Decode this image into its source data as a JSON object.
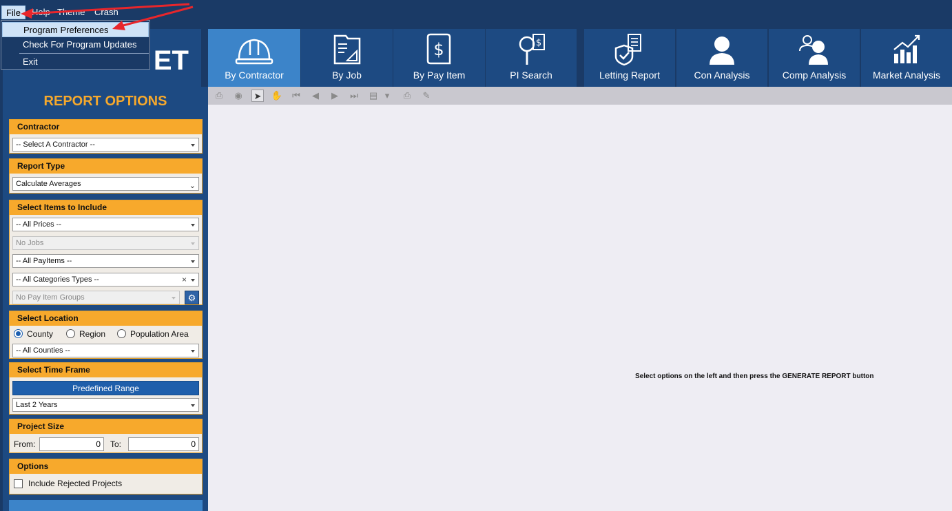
{
  "menubar": {
    "items": [
      {
        "label": "File"
      },
      {
        "label": "Help"
      },
      {
        "label": "Theme"
      },
      {
        "label": "Crash"
      }
    ]
  },
  "file_menu": {
    "items": [
      {
        "label": "Program Preferences"
      },
      {
        "label": "Check For Program Updates"
      },
      {
        "label": "Exit"
      }
    ]
  },
  "logo": {
    "text": "ET"
  },
  "tabs": [
    {
      "label": "By Contractor",
      "icon": "hard-hat-icon"
    },
    {
      "label": "By Job",
      "icon": "folder-icon"
    },
    {
      "label": "By Pay Item",
      "icon": "dollar-document-icon"
    },
    {
      "label": "PI Search",
      "icon": "magnifier-icon"
    },
    {
      "label": "Letting Report",
      "icon": "checklist-icon"
    },
    {
      "label": "Con Analysis",
      "icon": "person-icon"
    },
    {
      "label": "Comp Analysis",
      "icon": "people-icon"
    },
    {
      "label": "Market Analysis",
      "icon": "bar-chart-icon"
    }
  ],
  "report_options": {
    "title": "REPORT OPTIONS",
    "contractor": {
      "header": "Contractor",
      "value": "-- Select A Contractor --"
    },
    "report_type": {
      "header": "Report Type",
      "value": "Calculate Averages"
    },
    "items": {
      "header": "Select Items to Include",
      "prices": "-- All Prices --",
      "jobs": "No Jobs",
      "payitems": "-- All PayItems --",
      "categories": "-- All Categories Types --",
      "groups": "No Pay Item Groups"
    },
    "location": {
      "header": "Select Location",
      "options": [
        "County",
        "Region",
        "Population Area"
      ],
      "selected": "County",
      "value": "-- All Counties --"
    },
    "timeframe": {
      "header": "Select Time Frame",
      "button": "Predefined Range",
      "value": "Last 2 Years"
    },
    "project_size": {
      "header": "Project Size",
      "from_label": "From:",
      "from_value": "0",
      "to_label": "To:",
      "to_value": "0"
    },
    "options": {
      "header": "Options",
      "rejected_label": "Include Rejected Projects",
      "rejected_checked": false
    }
  },
  "viewer": {
    "message": "Select options on the left and then press the GENERATE REPORT button"
  },
  "colors": {
    "navy": "#1a3a66",
    "tab_blue": "#1d4a82",
    "active_tab": "#3c84c9",
    "orange": "#f7a92c",
    "annotation_red": "#e8262b"
  }
}
